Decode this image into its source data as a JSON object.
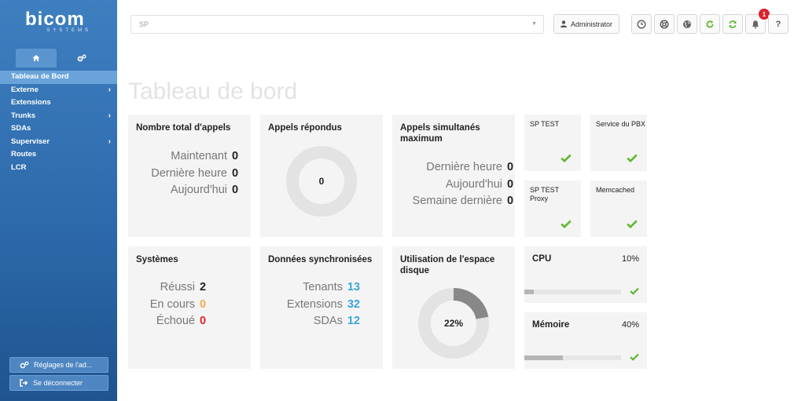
{
  "logo": {
    "brand": "bicom",
    "sub": "SYSTEMS"
  },
  "sidebar": {
    "tabs": [
      {
        "icon": "home-icon"
      },
      {
        "icon": "gears-icon"
      }
    ],
    "items": [
      {
        "label": "Tableau de Bord",
        "active": true,
        "has_submenu": false
      },
      {
        "label": "Externe",
        "has_submenu": true
      },
      {
        "label": "Extensions",
        "has_submenu": false
      },
      {
        "label": "Trunks",
        "has_submenu": true
      },
      {
        "label": "SDAs",
        "has_submenu": false
      },
      {
        "label": "Superviser",
        "has_submenu": true
      },
      {
        "label": "Routes",
        "has_submenu": false
      },
      {
        "label": "LCR",
        "has_submenu": false
      }
    ],
    "settings_label": "Réglages de l'ad...",
    "logout_label": "Se déconnecter"
  },
  "topbar": {
    "tenant_select": "SP",
    "user_label": "Administrator",
    "notification_count": "1",
    "help_label": "?"
  },
  "page_title": "Tableau de bord",
  "panels": {
    "total_calls": {
      "title": "Nombre total d'appels",
      "rows": [
        {
          "label": "Maintenant",
          "value": "0"
        },
        {
          "label": "Dernière heure",
          "value": "0"
        },
        {
          "label": "Aujourd'hui",
          "value": "0"
        }
      ]
    },
    "answered_calls": {
      "title": "Appels répondus",
      "center_value": "0"
    },
    "concurrent_calls": {
      "title": "Appels simultanés maximum",
      "rows": [
        {
          "label": "Dernière heure",
          "value": "0"
        },
        {
          "label": "Aujourd'hui",
          "value": "0"
        },
        {
          "label": "Semaine dernière",
          "value": "0"
        }
      ]
    },
    "systems": {
      "title": "Systèmes",
      "rows": [
        {
          "label": "Réussi",
          "value": "2",
          "color": "#222222"
        },
        {
          "label": "En cours",
          "value": "0",
          "color": "#f0ad4e"
        },
        {
          "label": "Échoué",
          "value": "0",
          "color": "#d9232d"
        }
      ]
    },
    "synced_data": {
      "title": "Données synchronisées",
      "rows": [
        {
          "label": "Tenants",
          "value": "13"
        },
        {
          "label": "Extensions",
          "value": "32"
        },
        {
          "label": "SDAs",
          "value": "12"
        }
      ]
    },
    "disk_usage": {
      "title": "Utilisation de l'espace disque",
      "value_label": "22%",
      "percent": 22
    }
  },
  "services": [
    {
      "name": "SP TEST",
      "status": "ok"
    },
    {
      "name": "Service du PBX",
      "status": "ok"
    },
    {
      "name": "SP TEST Proxy",
      "status": "ok"
    },
    {
      "name": "Memcached",
      "status": "ok"
    }
  ],
  "resources": {
    "cpu": {
      "label": "CPU",
      "value_label": "10%",
      "percent": 10
    },
    "memory": {
      "label": "Mémoire",
      "value_label": "40%",
      "percent": 40
    }
  },
  "colors": {
    "accent": "#2d6aab",
    "ok_green": "#5cb82e",
    "donut_track": "#e3e3e3",
    "donut_fill": "#888888"
  }
}
